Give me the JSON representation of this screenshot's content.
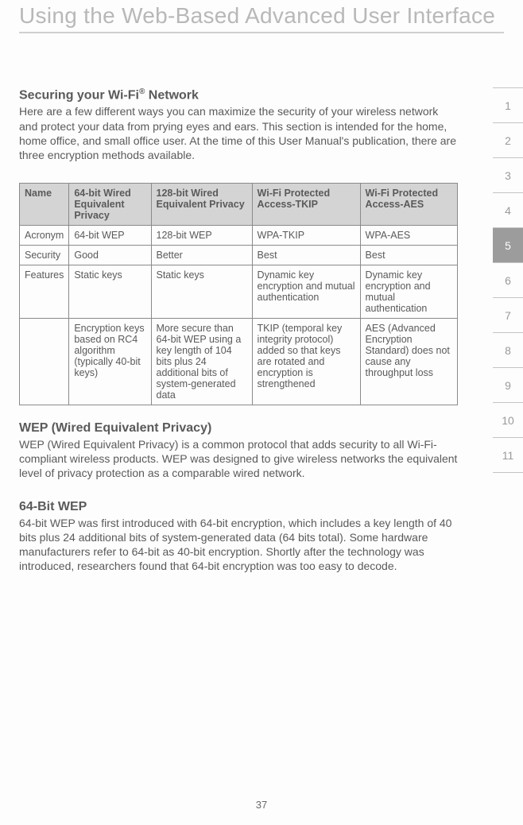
{
  "header": "Using the Web-Based Advanced User Interface",
  "securing": {
    "heading_pre": "Securing your Wi-Fi",
    "heading_sup": "®",
    "heading_post": " Network",
    "body": "Here are a few different ways you can maximize the security of your wireless network and protect your data from prying eyes and ears. This section is intended for the home, home office, and small office user. At the time of this User Manual's publication, there are three encryption methods available."
  },
  "table": {
    "headers": [
      "Name",
      "64-bit Wired Equivalent Privacy",
      "128-bit Wired Equivalent Privacy",
      "Wi-Fi Protected Access-TKIP",
      "Wi-Fi Protected Access-AES"
    ],
    "rows": [
      [
        "Acronym",
        "64-bit WEP",
        "128-bit WEP",
        "WPA-TKIP",
        "WPA-AES"
      ],
      [
        "Security",
        "Good",
        "Better",
        "Best",
        "Best"
      ],
      [
        "Features",
        "Static keys",
        "Static keys",
        "Dynamic key encryption and mutual authentication",
        "Dynamic key encryption and mutual authentication"
      ],
      [
        "",
        "Encryption keys based on RC4 algorithm (typically 40-bit keys)",
        "More secure than 64-bit WEP using a key length of 104 bits plus 24 additional bits of system-generated data",
        "TKIP (temporal key integrity protocol) added so that keys are rotated and encryption is strengthened",
        "AES (Advanced Encryption Standard) does not cause any throughput loss"
      ]
    ]
  },
  "wep": {
    "heading": "WEP (Wired Equivalent Privacy)",
    "body": "WEP (Wired Equivalent Privacy) is a common protocol that adds security to all Wi-Fi-compliant wireless products. WEP was designed to give wireless networks the equivalent level of privacy protection as a comparable wired network."
  },
  "wep64": {
    "heading": "64-Bit WEP",
    "body": "64-bit WEP was first introduced with 64-bit encryption, which includes a key length of 40 bits plus 24 additional bits of system-generated data (64 bits total). Some hardware manufacturers refer to 64-bit as 40-bit encryption. Shortly after the technology was introduced, researchers found that 64-bit encryption was too easy to decode."
  },
  "tabs": [
    "1",
    "2",
    "3",
    "4",
    "5",
    "6",
    "7",
    "8",
    "9",
    "10",
    "11"
  ],
  "active_tab": "5",
  "page_number": "37"
}
